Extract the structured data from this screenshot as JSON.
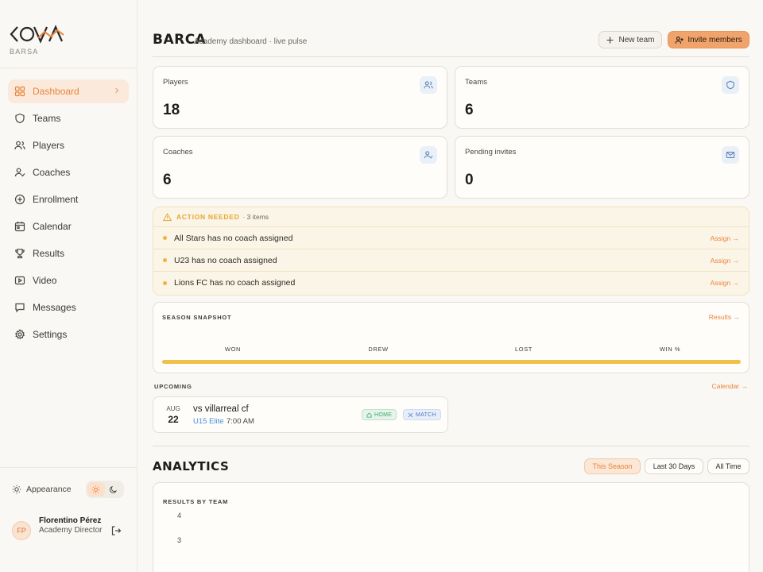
{
  "brand": {
    "name": "KOVA",
    "subtitle": "BARSA"
  },
  "sidebar": {
    "items": [
      {
        "label": "Dashboard",
        "icon": "dashboard-icon",
        "active": true
      },
      {
        "label": "Teams",
        "icon": "shield-icon"
      },
      {
        "label": "Players",
        "icon": "users-icon"
      },
      {
        "label": "Coaches",
        "icon": "user-check-icon"
      },
      {
        "label": "Enrollment",
        "icon": "plus-circle-icon"
      },
      {
        "label": "Calendar",
        "icon": "calendar-icon"
      },
      {
        "label": "Results",
        "icon": "trophy-icon"
      },
      {
        "label": "Video",
        "icon": "video-icon"
      },
      {
        "label": "Messages",
        "icon": "message-icon"
      },
      {
        "label": "Settings",
        "icon": "gear-icon"
      }
    ],
    "appearance_label": "Appearance",
    "user": {
      "initials": "FP",
      "name": "Florentino Pérez",
      "role": "Academy Director"
    }
  },
  "header": {
    "title": "BARCA",
    "subtitle": "Academy dashboard · live pulse",
    "new_team_label": "New team",
    "invite_label": "Invite members"
  },
  "stats": [
    {
      "label": "Players",
      "value": "18",
      "icon": "users-icon"
    },
    {
      "label": "Teams",
      "value": "6",
      "icon": "shield-icon"
    },
    {
      "label": "Coaches",
      "value": "6",
      "icon": "user-check-icon"
    },
    {
      "label": "Pending invites",
      "value": "0",
      "icon": "mail-icon"
    }
  ],
  "action_needed": {
    "title": "ACTION NEEDED",
    "count": "· 3 items",
    "items": [
      {
        "text": "All Stars has no coach assigned",
        "action": "Assign →"
      },
      {
        "text": "U23 has no coach assigned",
        "action": "Assign →"
      },
      {
        "text": "Lions FC has no coach assigned",
        "action": "Assign →"
      }
    ]
  },
  "season_snapshot": {
    "title": "SEASON SNAPSHOT",
    "link": "Results →",
    "columns": [
      "WON",
      "DREW",
      "LOST",
      "WIN %"
    ],
    "bar_color": "#efc247"
  },
  "upcoming": {
    "title": "UPCOMING",
    "link": "Calendar →",
    "match": {
      "month": "AUG",
      "day": "22",
      "title": "vs villarreal cf",
      "team": "U15 Elite",
      "time": "7:00 AM",
      "badge_home": "HOME",
      "badge_match": "MATCH"
    }
  },
  "analytics": {
    "title": "ANALYTICS",
    "filters": [
      {
        "label": "This Season",
        "active": true
      },
      {
        "label": "Last 30 Days",
        "active": false
      },
      {
        "label": "All Time",
        "active": false
      }
    ],
    "chart_title": "RESULTS BY TEAM",
    "y_ticks": [
      "4",
      "3"
    ]
  },
  "colors": {
    "accent": "#e8843d",
    "accent_bg": "#f0a36a",
    "warning": "#f0b53a",
    "link_blue": "#4a90d9"
  }
}
